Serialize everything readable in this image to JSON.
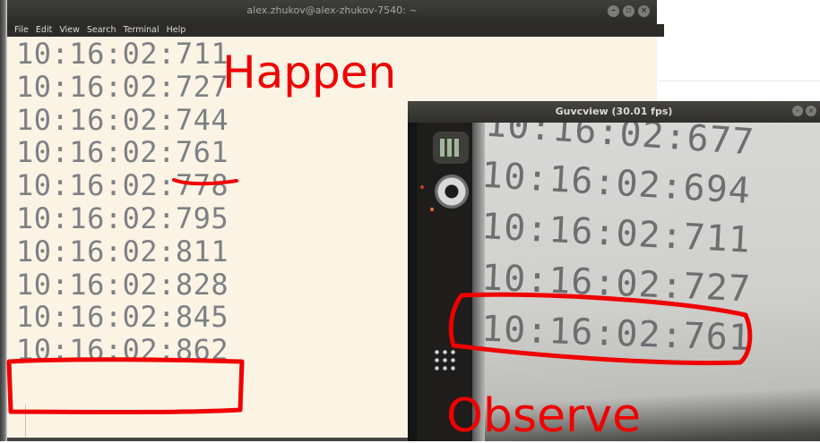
{
  "terminal": {
    "title": "alex.zhukov@alex-zhukov-7540: ~",
    "window_buttons": [
      "–",
      "▫",
      "×"
    ],
    "menu": [
      "File",
      "Edit",
      "View",
      "Search",
      "Terminal",
      "Help"
    ],
    "lines": [
      "10:16:02:711",
      "10:16:02:727",
      "10:16:02:744",
      "10:16:02:761",
      "10:16:02:778",
      "10:16:02:795",
      "10:16:02:811",
      "10:16:02:828",
      "10:16:02:845",
      "10:16:02:862"
    ]
  },
  "guvcview": {
    "title": "Guvcview (30.01 fps)",
    "window_buttons": [
      "–",
      "×"
    ],
    "camera_lines": [
      "10:16:02:677",
      "10:16:02:694",
      "10:16:02:711",
      "10:16:02:727",
      "10:16:02:761"
    ],
    "launcher_icons": [
      "calculator-icon",
      "webcam-icon",
      "apps-grid-icon"
    ]
  },
  "annotations": {
    "happen": "Happen",
    "observe": "Observe",
    "color": "#f00000"
  }
}
